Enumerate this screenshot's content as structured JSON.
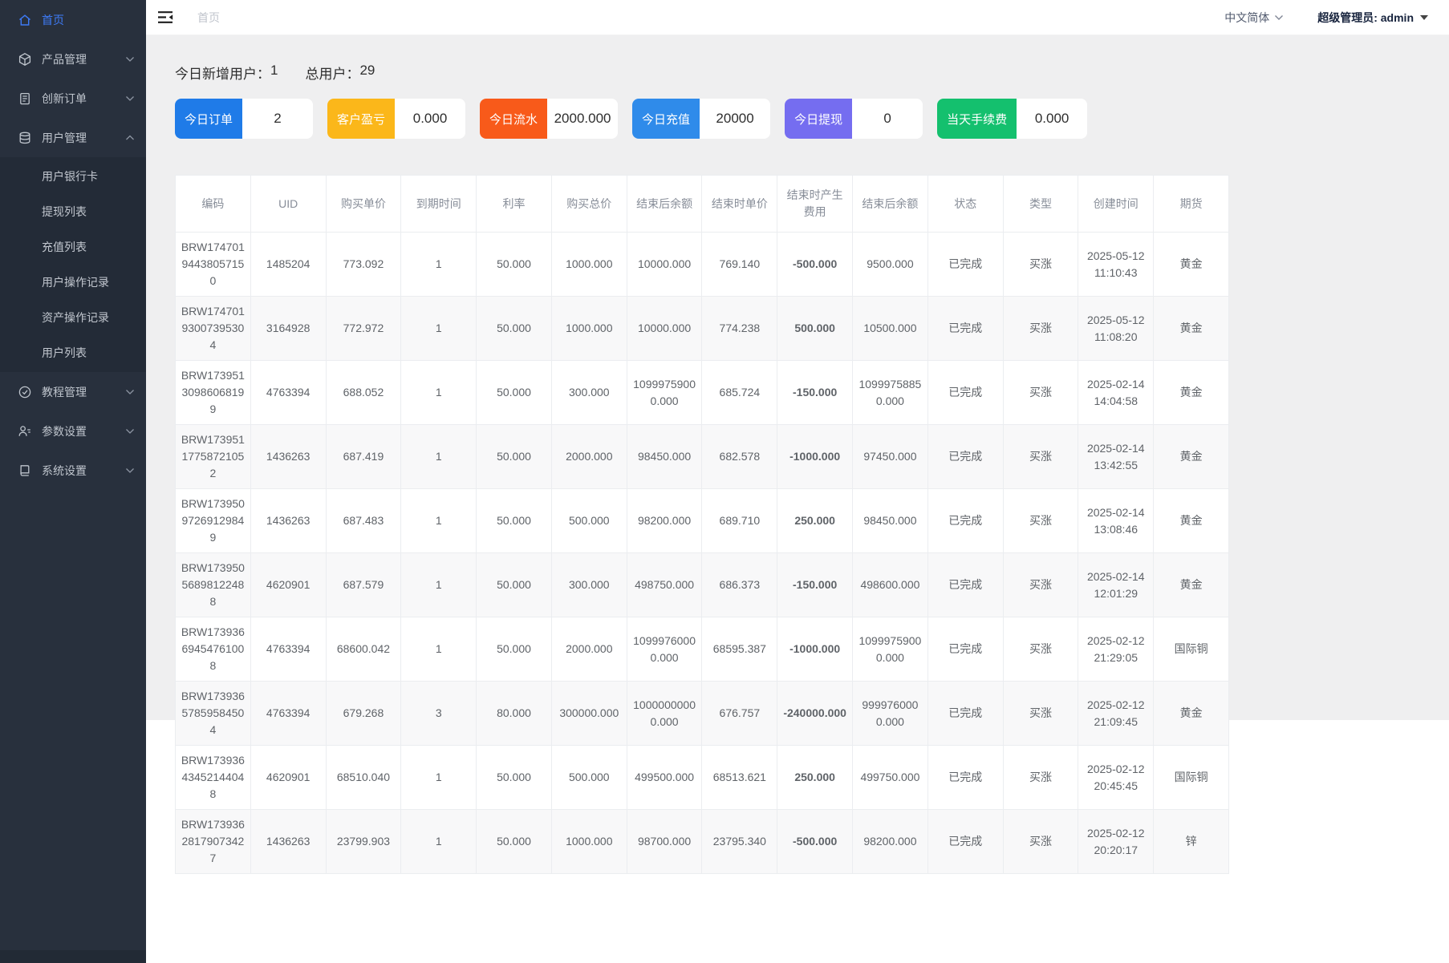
{
  "topbar": {
    "breadcrumb": "首页",
    "language": "中文简体",
    "user": "超级管理员: admin"
  },
  "sidebar": {
    "items": [
      {
        "id": "home",
        "label": "首页",
        "icon": "home",
        "active": true
      },
      {
        "id": "product",
        "label": "产品管理",
        "icon": "product",
        "chevron": "down"
      },
      {
        "id": "order",
        "label": "创新订单",
        "icon": "order",
        "chevron": "down"
      },
      {
        "id": "user",
        "label": "用户管理",
        "icon": "userdb",
        "chevron": "up",
        "children": [
          {
            "id": "bank-card",
            "label": "用户银行卡"
          },
          {
            "id": "withdraw-list",
            "label": "提现列表"
          },
          {
            "id": "recharge-list",
            "label": "充值列表"
          },
          {
            "id": "user-op-log",
            "label": "用户操作记录"
          },
          {
            "id": "asset-op-log",
            "label": "资产操作记录"
          },
          {
            "id": "user-list",
            "label": "用户列表"
          }
        ]
      },
      {
        "id": "tutorial",
        "label": "教程管理",
        "icon": "tutorial",
        "chevron": "down"
      },
      {
        "id": "params",
        "label": "参数设置",
        "icon": "params",
        "chevron": "down"
      },
      {
        "id": "system",
        "label": "系统设置",
        "icon": "system",
        "chevron": "down"
      }
    ]
  },
  "stats": {
    "new_users_label": "今日新增用户：",
    "new_users": "1",
    "total_users_label": "总用户：",
    "total_users": "29"
  },
  "cards": [
    {
      "label": "今日订单",
      "value": "2",
      "color": "#1f7be8"
    },
    {
      "label": "客户盈亏",
      "value": "0.000",
      "color": "#fbb71a"
    },
    {
      "label": "今日流水",
      "value": "2000.000",
      "color": "#f85a1a"
    },
    {
      "label": "今日充值",
      "value": "20000",
      "color": "#2f8bea"
    },
    {
      "label": "今日提现",
      "value": "0",
      "color": "#756df0"
    },
    {
      "label": "当天手续费",
      "value": "0.000",
      "color": "#14c06e"
    }
  ],
  "table": {
    "headers": [
      "编码",
      "UID",
      "购买单价",
      "到期时间",
      "利率",
      "购买总价",
      "结束后余额",
      "结束时单价",
      "结束时产生费用",
      "结束后余额",
      "状态",
      "类型",
      "创建时间",
      "期货"
    ],
    "rows": [
      {
        "code": "BRW17470194438057150",
        "uid": "1485204",
        "buy_price": "773.092",
        "expire": "1",
        "rate": "50.000",
        "total": "1000.000",
        "balance_after": "10000.000",
        "end_price": "769.140",
        "fee": "-500.000",
        "fee_color": "green",
        "balance_after2": "9500.000",
        "status": "已完成",
        "type": "买涨",
        "created": "2025-05-12 11:10:43",
        "futures": "黄金"
      },
      {
        "code": "BRW17470193007395304",
        "uid": "3164928",
        "buy_price": "772.972",
        "expire": "1",
        "rate": "50.000",
        "total": "1000.000",
        "balance_after": "10000.000",
        "end_price": "774.238",
        "fee": "500.000",
        "fee_color": "red",
        "balance_after2": "10500.000",
        "status": "已完成",
        "type": "买涨",
        "created": "2025-05-12 11:08:20",
        "futures": "黄金"
      },
      {
        "code": "BRW17395130986068199",
        "uid": "4763394",
        "buy_price": "688.052",
        "expire": "1",
        "rate": "50.000",
        "total": "300.000",
        "balance_after": "10999759000.000",
        "end_price": "685.724",
        "fee": "-150.000",
        "fee_color": "green",
        "balance_after2": "10999758850.000",
        "status": "已完成",
        "type": "买涨",
        "created": "2025-02-14 14:04:58",
        "futures": "黄金"
      },
      {
        "code": "BRW17395117758721052",
        "uid": "1436263",
        "buy_price": "687.419",
        "expire": "1",
        "rate": "50.000",
        "total": "2000.000",
        "balance_after": "98450.000",
        "end_price": "682.578",
        "fee": "-1000.000",
        "fee_color": "green",
        "balance_after2": "97450.000",
        "status": "已完成",
        "type": "买涨",
        "created": "2025-02-14 13:42:55",
        "futures": "黄金"
      },
      {
        "code": "BRW17395097269129849",
        "uid": "1436263",
        "buy_price": "687.483",
        "expire": "1",
        "rate": "50.000",
        "total": "500.000",
        "balance_after": "98200.000",
        "end_price": "689.710",
        "fee": "250.000",
        "fee_color": "red",
        "balance_after2": "98450.000",
        "status": "已完成",
        "type": "买涨",
        "created": "2025-02-14 13:08:46",
        "futures": "黄金"
      },
      {
        "code": "BRW17395056898122488",
        "uid": "4620901",
        "buy_price": "687.579",
        "expire": "1",
        "rate": "50.000",
        "total": "300.000",
        "balance_after": "498750.000",
        "end_price": "686.373",
        "fee": "-150.000",
        "fee_color": "green",
        "balance_after2": "498600.000",
        "status": "已完成",
        "type": "买涨",
        "created": "2025-02-14 12:01:29",
        "futures": "黄金"
      },
      {
        "code": "BRW17393669454761008",
        "uid": "4763394",
        "buy_price": "68600.042",
        "expire": "1",
        "rate": "50.000",
        "total": "2000.000",
        "balance_after": "10999760000.000",
        "end_price": "68595.387",
        "fee": "-1000.000",
        "fee_color": "green",
        "balance_after2": "10999759000.000",
        "status": "已完成",
        "type": "买涨",
        "created": "2025-02-12 21:29:05",
        "futures": "国际铜"
      },
      {
        "code": "BRW17393657859584504",
        "uid": "4763394",
        "buy_price": "679.268",
        "expire": "3",
        "rate": "80.000",
        "total": "300000.000",
        "balance_after": "10000000000.000",
        "end_price": "676.757",
        "fee": "-240000.000",
        "fee_color": "green",
        "balance_after2": "9999760000.000",
        "status": "已完成",
        "type": "买涨",
        "created": "2025-02-12 21:09:45",
        "futures": "黄金"
      },
      {
        "code": "BRW17393643452144048",
        "uid": "4620901",
        "buy_price": "68510.040",
        "expire": "1",
        "rate": "50.000",
        "total": "500.000",
        "balance_after": "499500.000",
        "end_price": "68513.621",
        "fee": "250.000",
        "fee_color": "red",
        "balance_after2": "499750.000",
        "status": "已完成",
        "type": "买涨",
        "created": "2025-02-12 20:45:45",
        "futures": "国际铜"
      },
      {
        "code": "BRW17393628179073427",
        "uid": "1436263",
        "buy_price": "23799.903",
        "expire": "1",
        "rate": "50.000",
        "total": "1000.000",
        "balance_after": "98700.000",
        "end_price": "23795.340",
        "fee": "-500.000",
        "fee_color": "green",
        "balance_after2": "98200.000",
        "status": "已完成",
        "type": "买涨",
        "created": "2025-02-12 20:20:17",
        "futures": "锌"
      }
    ]
  }
}
